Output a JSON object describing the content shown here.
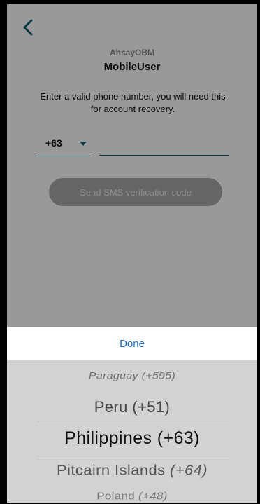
{
  "header": {
    "back_icon": "chevron-left-icon",
    "app_name": "AhsayOBM",
    "user_name": "MobileUser"
  },
  "form": {
    "instructions": "Enter a valid phone number, you will need this for account recovery.",
    "country_code": "+63",
    "caret_icon": "caret-down-icon",
    "phone_value": "",
    "send_button": "Send SMS verification code"
  },
  "picker": {
    "done_label": "Done",
    "items": [
      {
        "country": "Paraguay",
        "code": "(+595)"
      },
      {
        "country": "Peru",
        "code": "(+51)"
      },
      {
        "country": "Philippines",
        "code": "(+63)"
      },
      {
        "country": "Pitcairn Islands",
        "code": "(+64)"
      },
      {
        "country": "Poland",
        "code": "(+48)"
      }
    ],
    "selected_index": 2
  },
  "colors": {
    "accent": "#0f5d73",
    "done": "#1f6fc9",
    "button_disabled": "#a9a9a9",
    "picker_bg": "#d2d2d2"
  }
}
